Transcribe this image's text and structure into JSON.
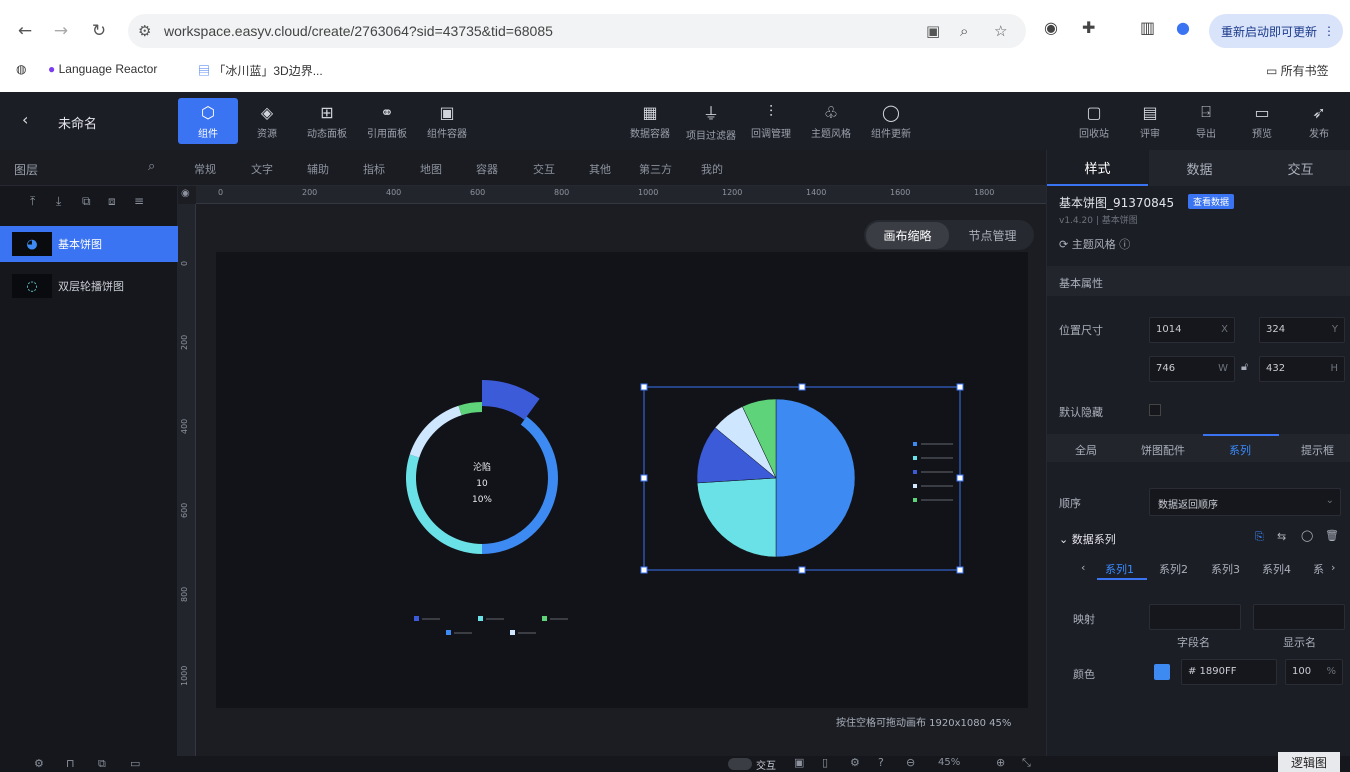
{
  "browser": {
    "url": "workspace.easyv.cloud/create/2763064?sid=43735&tid=68085",
    "update_label": "重新启动即可更新",
    "bookmarks": [
      "Language Reactor",
      "「冰川蓝」3D边界..."
    ],
    "all_bookmarks": "所有书签"
  },
  "app": {
    "project_name": "未命名",
    "toolbar_left": [
      {
        "icon": "component-icon",
        "label": "组件"
      },
      {
        "icon": "layers-icon",
        "label": "资源"
      },
      {
        "icon": "panel-icon",
        "label": "动态面板"
      },
      {
        "icon": "link-icon",
        "label": "引用面板"
      },
      {
        "icon": "container-icon",
        "label": "组件容器"
      }
    ],
    "toolbar_mid": [
      {
        "icon": "data-icon",
        "label": "数据容器"
      },
      {
        "icon": "filter-icon",
        "label": "项目过滤器"
      },
      {
        "icon": "callback-icon",
        "label": "回调管理"
      },
      {
        "icon": "theme-icon",
        "label": "主题风格"
      },
      {
        "icon": "update-icon",
        "label": "组件更新"
      }
    ],
    "toolbar_right": [
      {
        "icon": "recycle-icon",
        "label": "回收站"
      },
      {
        "icon": "comment-icon",
        "label": "评审"
      },
      {
        "icon": "export-icon",
        "label": "导出"
      },
      {
        "icon": "preview-icon",
        "label": "预览"
      },
      {
        "icon": "publish-icon",
        "label": "发布"
      }
    ],
    "categories": [
      "图层",
      "常规",
      "文字",
      "辅助",
      "指标",
      "地图",
      "容器",
      "交互",
      "其他",
      "第三方",
      "我的"
    ],
    "layers": [
      {
        "name": "基本饼图"
      },
      {
        "name": "双层轮播饼图"
      }
    ],
    "canvas": {
      "ruler_h": [
        "0",
        "200",
        "400",
        "600",
        "800",
        "1000",
        "1200",
        "1400",
        "1600",
        "1800"
      ],
      "ruler_v": [
        "0",
        "200",
        "400",
        "600",
        "800",
        "1000"
      ],
      "seg": [
        "画布缩略",
        "节点管理"
      ],
      "status": "按住空格可拖动画布   1920x1080 45%"
    },
    "donut": {
      "center": [
        "沦陷",
        "10",
        "10%"
      ]
    },
    "right": {
      "tabs": [
        "样式",
        "数据",
        "交互"
      ],
      "component_name": "基本饼图_91370845",
      "view_data": "查看数据",
      "version": "v1.4.20 | 基本饼图",
      "theme": "主题风格",
      "basic_props": "基本属性",
      "position_label": "位置尺寸",
      "x": "1014",
      "y": "324",
      "w": "746",
      "h": "432",
      "hidden_label": "默认隐藏",
      "subtabs": [
        "全局",
        "饼图配件",
        "系列",
        "提示框"
      ],
      "order_label": "顺序",
      "order_value": "数据返回顺序",
      "series_title": "数据系列",
      "series_tabs": [
        "系列1",
        "系列2",
        "系列3",
        "系列4",
        "系"
      ],
      "mapping_label": "映射",
      "field_label": "字段名",
      "display_label": "显示名",
      "color_label": "颜色",
      "color_value": "# 1890FF",
      "opacity": "100"
    },
    "logic_button": "逻辑图",
    "bottom_label": "交互",
    "zoom": "45%"
  },
  "chart_data": [
    {
      "type": "pie",
      "values": [
        50,
        24,
        12,
        7,
        7
      ],
      "colors": [
        "#3d8bf2",
        "#6ae1e6",
        "#3b5bd9",
        "#cfe6ff",
        "#5fd37a"
      ],
      "legend_position": "right"
    },
    {
      "type": "pie",
      "values": [
        10,
        40,
        30,
        15,
        5
      ],
      "colors": [
        "#3b5bd9",
        "#3d8bf2",
        "#6ae1e6",
        "#cfe6ff",
        "#5fd37a"
      ],
      "legend_position": "bottom"
    }
  ]
}
